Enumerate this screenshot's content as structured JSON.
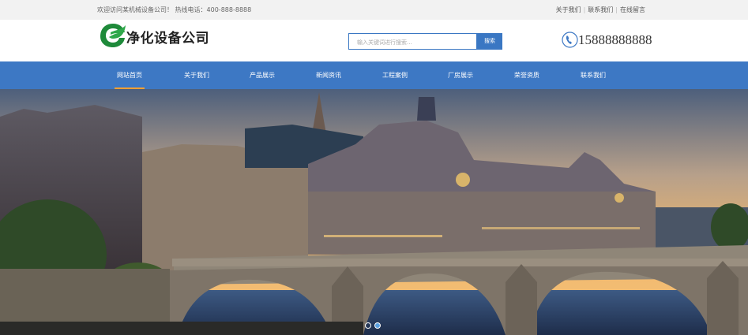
{
  "topbar": {
    "welcome": "欢迎访问某机械设备公司！  热线电话：400-888-8888",
    "links": [
      "关于我们",
      "联系我们",
      "在线留言"
    ]
  },
  "header": {
    "company_name": "净化设备公司",
    "search_placeholder": "输入关键词进行搜索...",
    "search_button": "搜索",
    "phone": "15888888888"
  },
  "nav": {
    "items": [
      "网站首页",
      "关于我们",
      "产品展示",
      "新闻资讯",
      "工程案例",
      "厂房展示",
      "荣誉资质",
      "联系我们"
    ],
    "active_index": 0
  },
  "banner": {
    "slide_count": 2,
    "active_slide": 1
  },
  "colors": {
    "brand_blue": "#3d78c4",
    "nav_active_underline": "#f7a032",
    "logo_green": "#1e8a3a"
  }
}
